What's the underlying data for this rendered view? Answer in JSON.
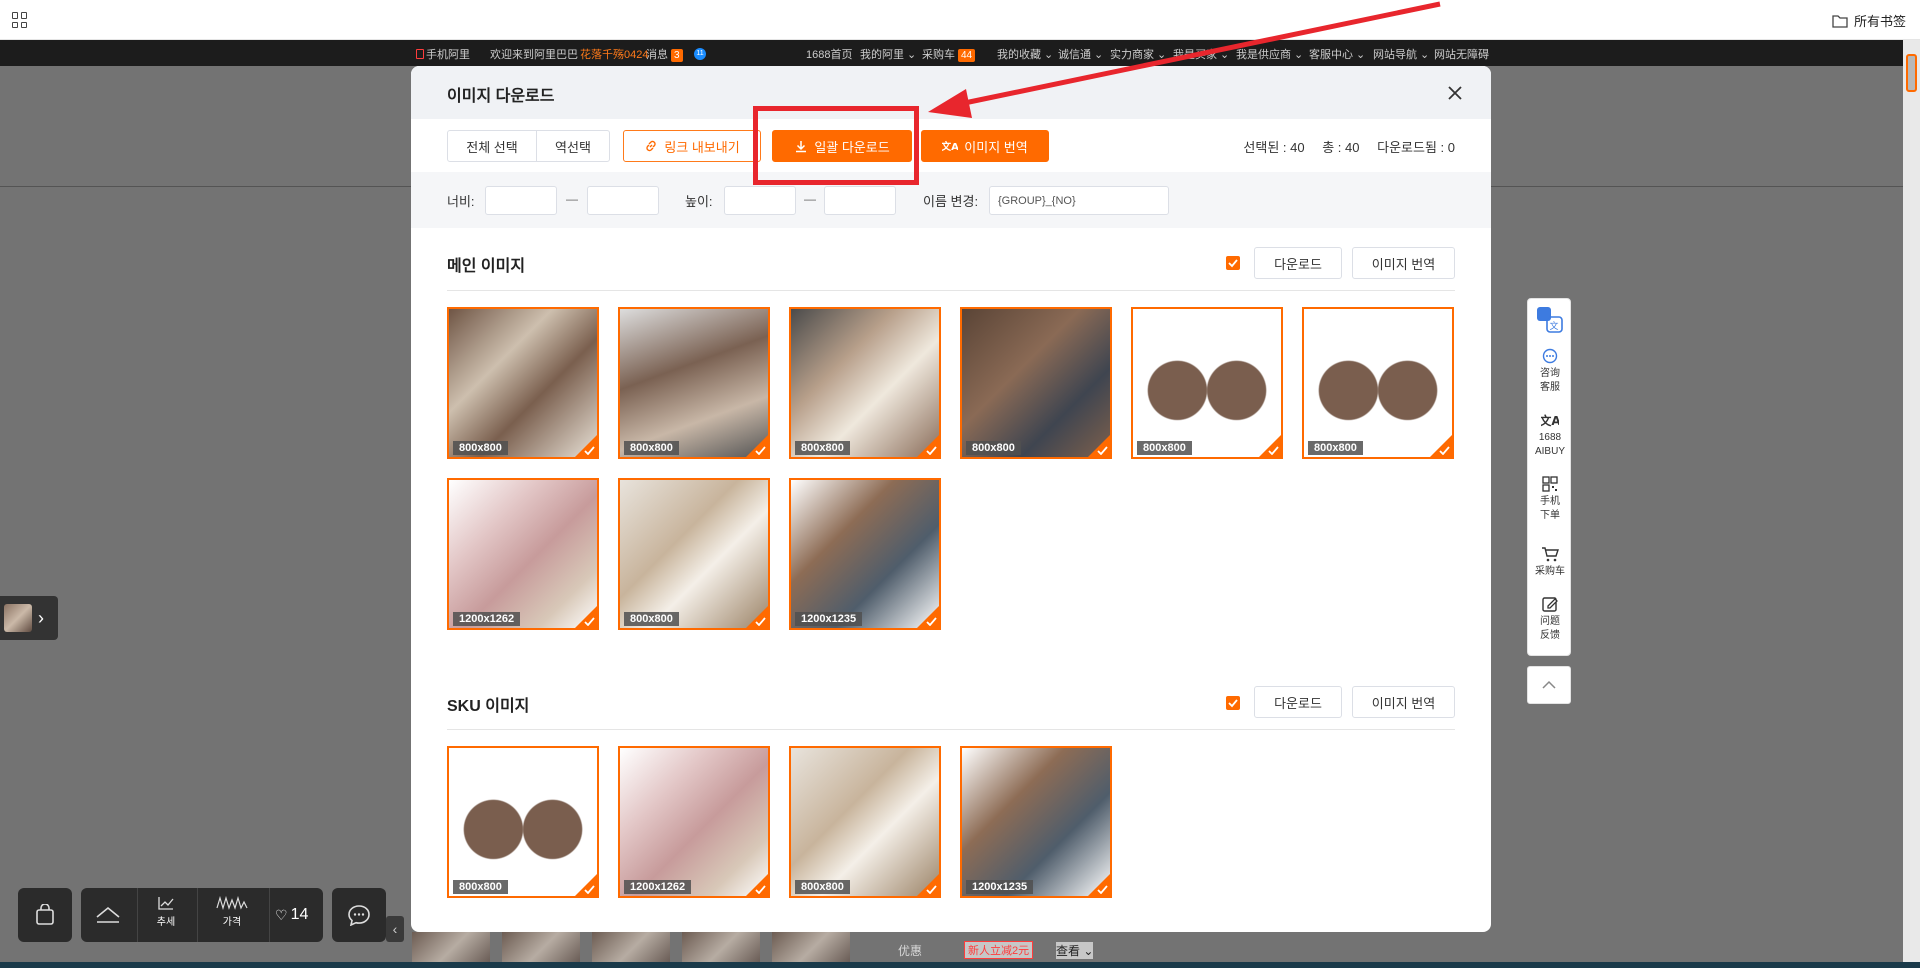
{
  "bookmarks_bar": {
    "apps_icon": "apps-grid-icon",
    "folder_label": "所有书签"
  },
  "site_bar": {
    "mobile": "手机阿里",
    "welcome": "欢迎来到阿里巴巴",
    "user": "花落千殇0424",
    "messages": "消息",
    "messages_count": "3",
    "chat_badge": "11",
    "home": "1688首页",
    "my_ali": "我的阿里 ⌄",
    "cart": "采购车",
    "cart_count": "44",
    "favorites": "我的收藏 ⌄",
    "chengxintong": "诚信通 ⌄",
    "merchants": "实力商家 ⌄",
    "buyers": "我是买家 ⌄",
    "supplier": "我是供应商 ⌄",
    "service": "客服中心 ⌄",
    "nav": "网站导航 ⌄",
    "accessible": "网站无障碍"
  },
  "modal": {
    "title": "이미지 다운로드",
    "toolbar": {
      "select_all": "전체 선택",
      "invert": "역선택",
      "export_links": "링크 내보내기",
      "bulk_download": "일괄 다운로드",
      "translate": "이미지 번역"
    },
    "stats": {
      "selected": "선택된 : 40",
      "total": "총 : 40",
      "downloaded": "다운로드됨 : 0"
    },
    "filters": {
      "width_label": "너비:",
      "height_label": "높이:",
      "dash": "—",
      "rename_label": "이름 변경:",
      "rename_value": "{GROUP}_{NO}"
    },
    "sections": [
      {
        "title": "메인 이미지",
        "download": "다운로드",
        "translate": "이미지 번역",
        "images": [
          "800x800",
          "800x800",
          "800x800",
          "800x800",
          "800x800",
          "800x800",
          "1200x1262",
          "800x800",
          "1200x1235"
        ]
      },
      {
        "title": "SKU 이미지",
        "download": "다운로드",
        "translate": "이미지 번역",
        "images": [
          "800x800",
          "1200x1262",
          "800x800",
          "1200x1235"
        ]
      }
    ]
  },
  "side_panel": {
    "items": [
      {
        "icon": "translate-icon",
        "label": ""
      },
      {
        "icon": "chat-icon",
        "label": "咨询\n客服"
      },
      {
        "icon": "aibuy-icon",
        "label": "1688\nAIBUY"
      },
      {
        "icon": "qrcode-icon",
        "label": "手机\n下单"
      },
      {
        "icon": "cart-icon",
        "label": "采购车"
      },
      {
        "icon": "edit-icon",
        "label": "问题\n反馈"
      }
    ]
  },
  "bottom_tools": {
    "trend": "추세",
    "price": "가격",
    "likes": "14"
  },
  "bottom_strip": {
    "label": "优惠",
    "coupon": "新人立减2元",
    "view": "查看 ⌄"
  },
  "colors": {
    "accent": "#ff6a00",
    "highlight": "#e8262d"
  }
}
